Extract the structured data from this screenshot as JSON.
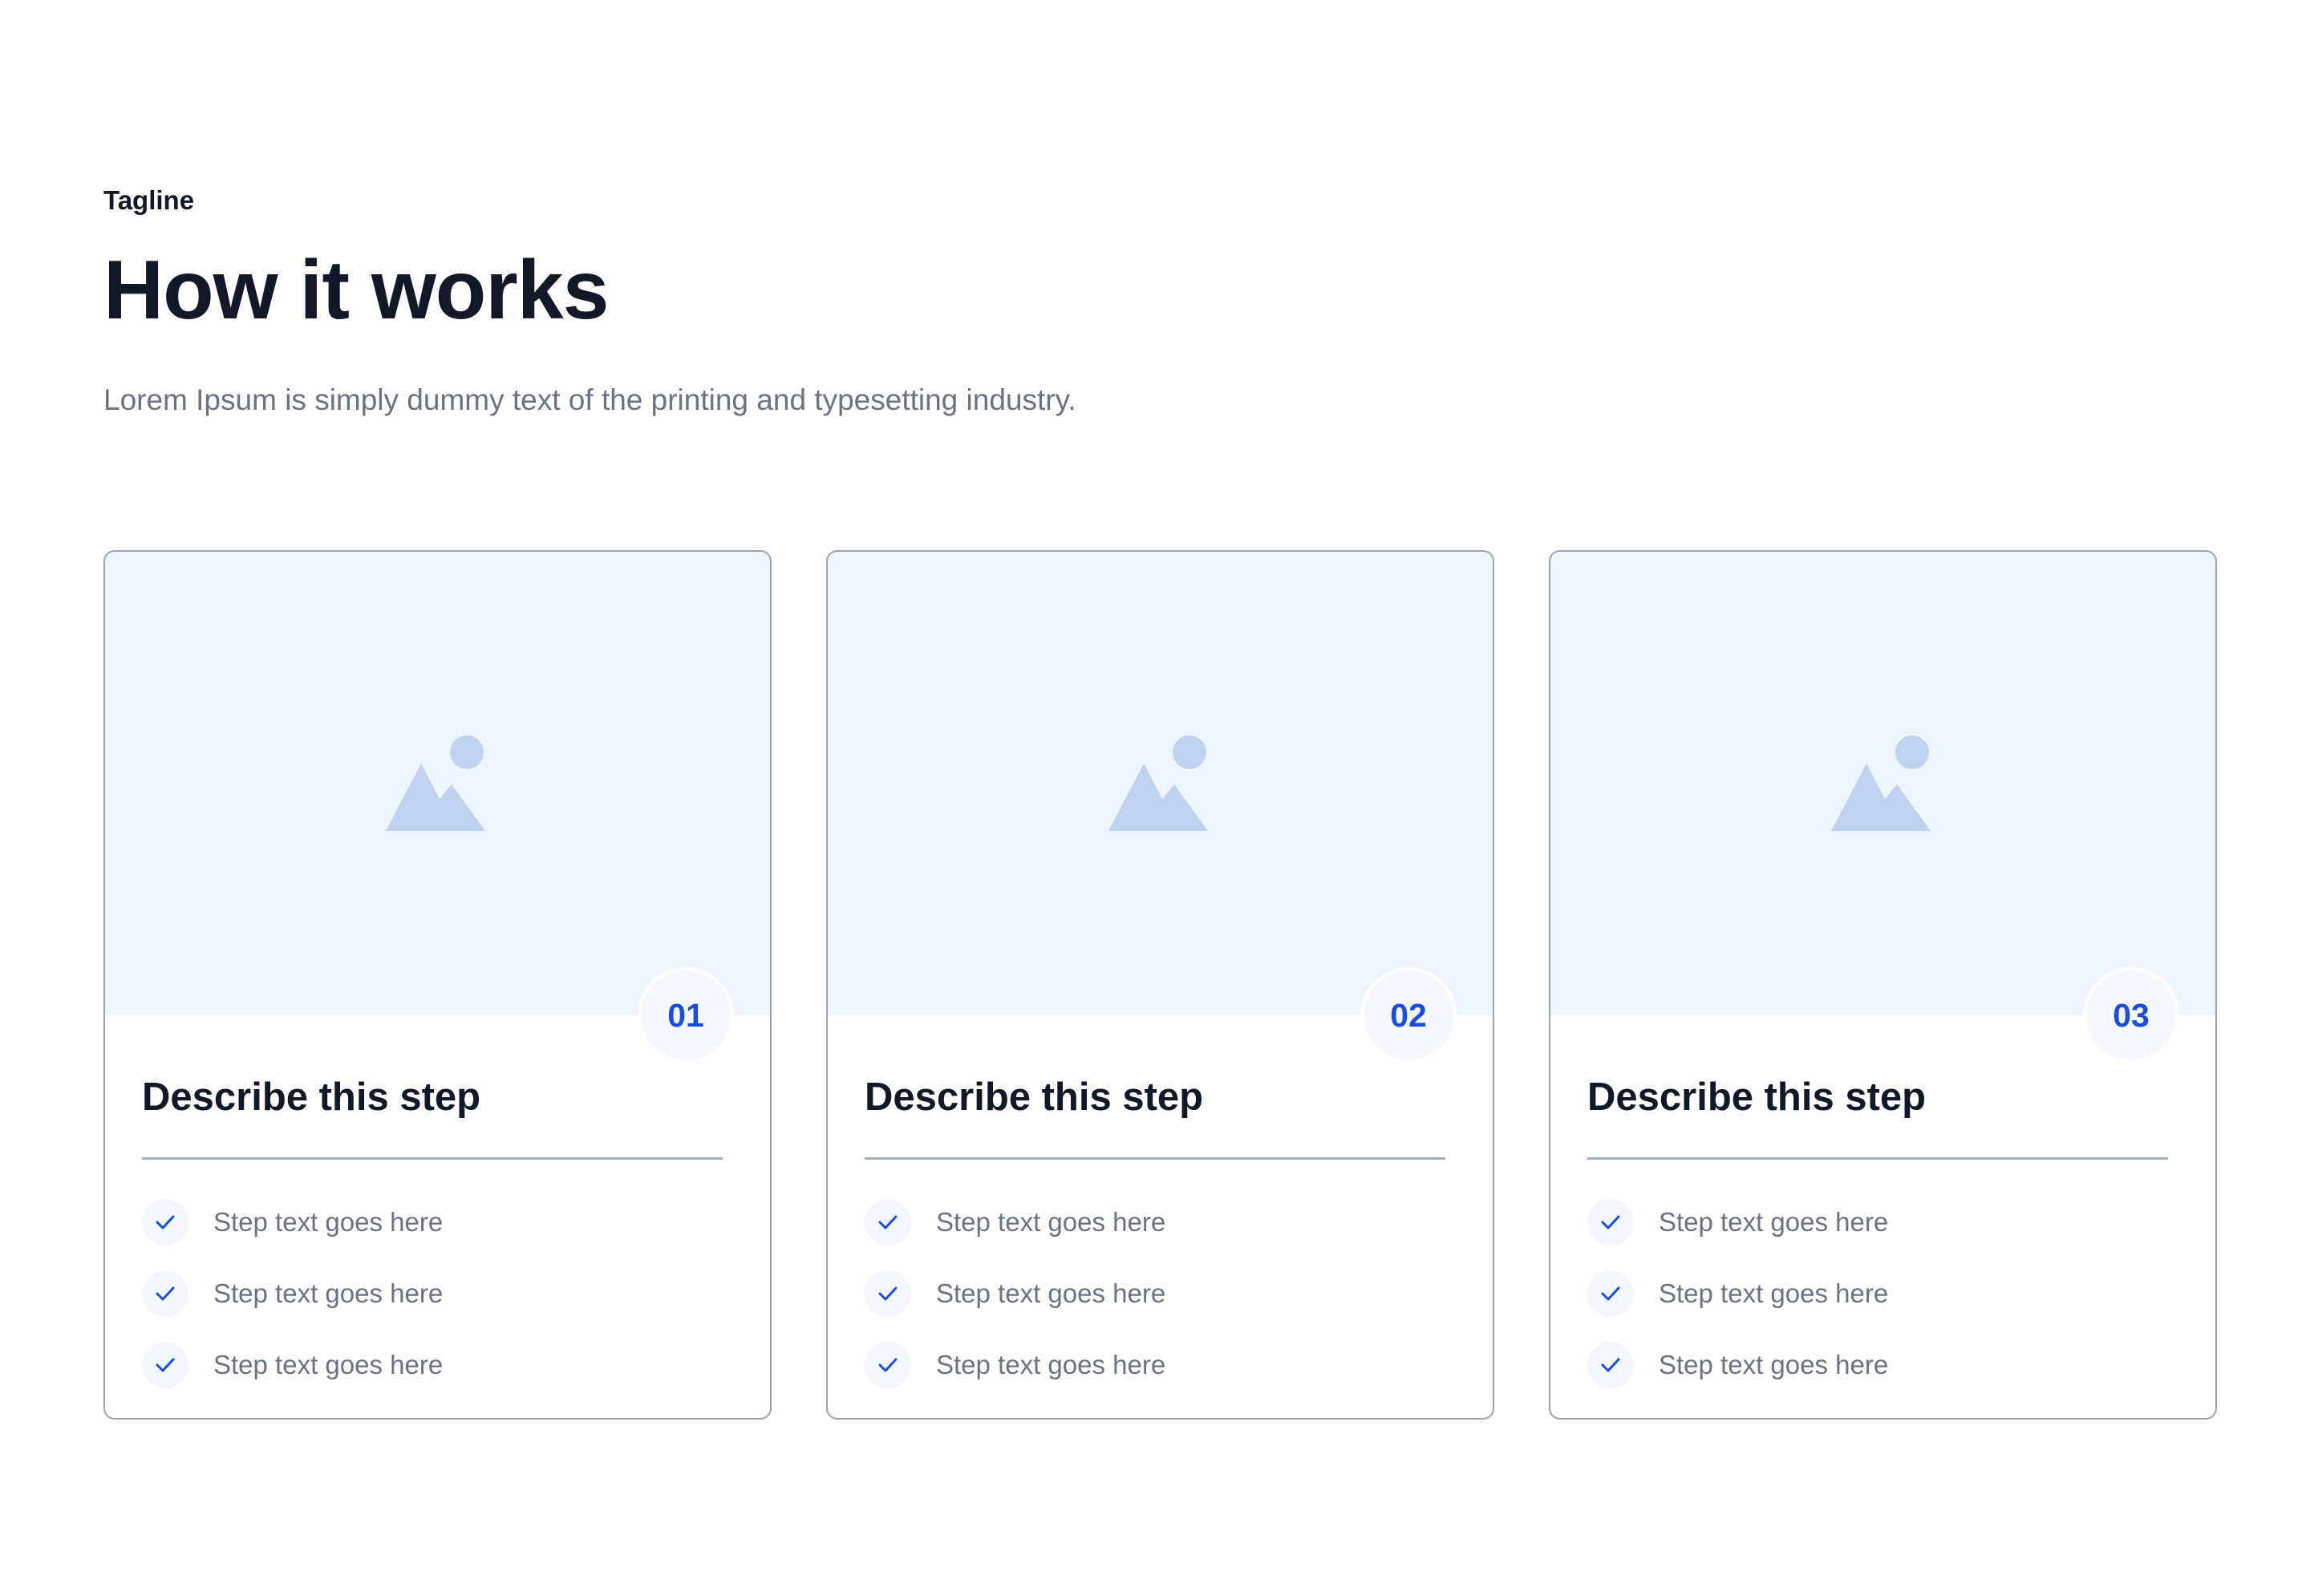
{
  "header": {
    "tagline": "Tagline",
    "title": "How it works",
    "subtitle": "Lorem Ipsum is simply dummy text of the printing and typesetting industry."
  },
  "cards": [
    {
      "number": "01",
      "title": "Describe this step",
      "image_icon": "image-placeholder-icon",
      "items": [
        "Step text goes here",
        "Step text goes here",
        "Step text goes here"
      ]
    },
    {
      "number": "02",
      "title": "Describe this step",
      "image_icon": "image-placeholder-icon",
      "items": [
        "Step text goes here",
        "Step text goes here",
        "Step text goes here"
      ]
    },
    {
      "number": "03",
      "title": "Describe this step",
      "image_icon": "image-placeholder-icon",
      "items": [
        "Step text goes here",
        "Step text goes here",
        "Step text goes here"
      ]
    }
  ],
  "colors": {
    "heading": "#111827",
    "body_text": "#6b7280",
    "accent": "#1d4ed8",
    "media_background": "#eef5fe",
    "placeholder_icon": "#bfd3ee",
    "card_border": "#9ca3af"
  }
}
